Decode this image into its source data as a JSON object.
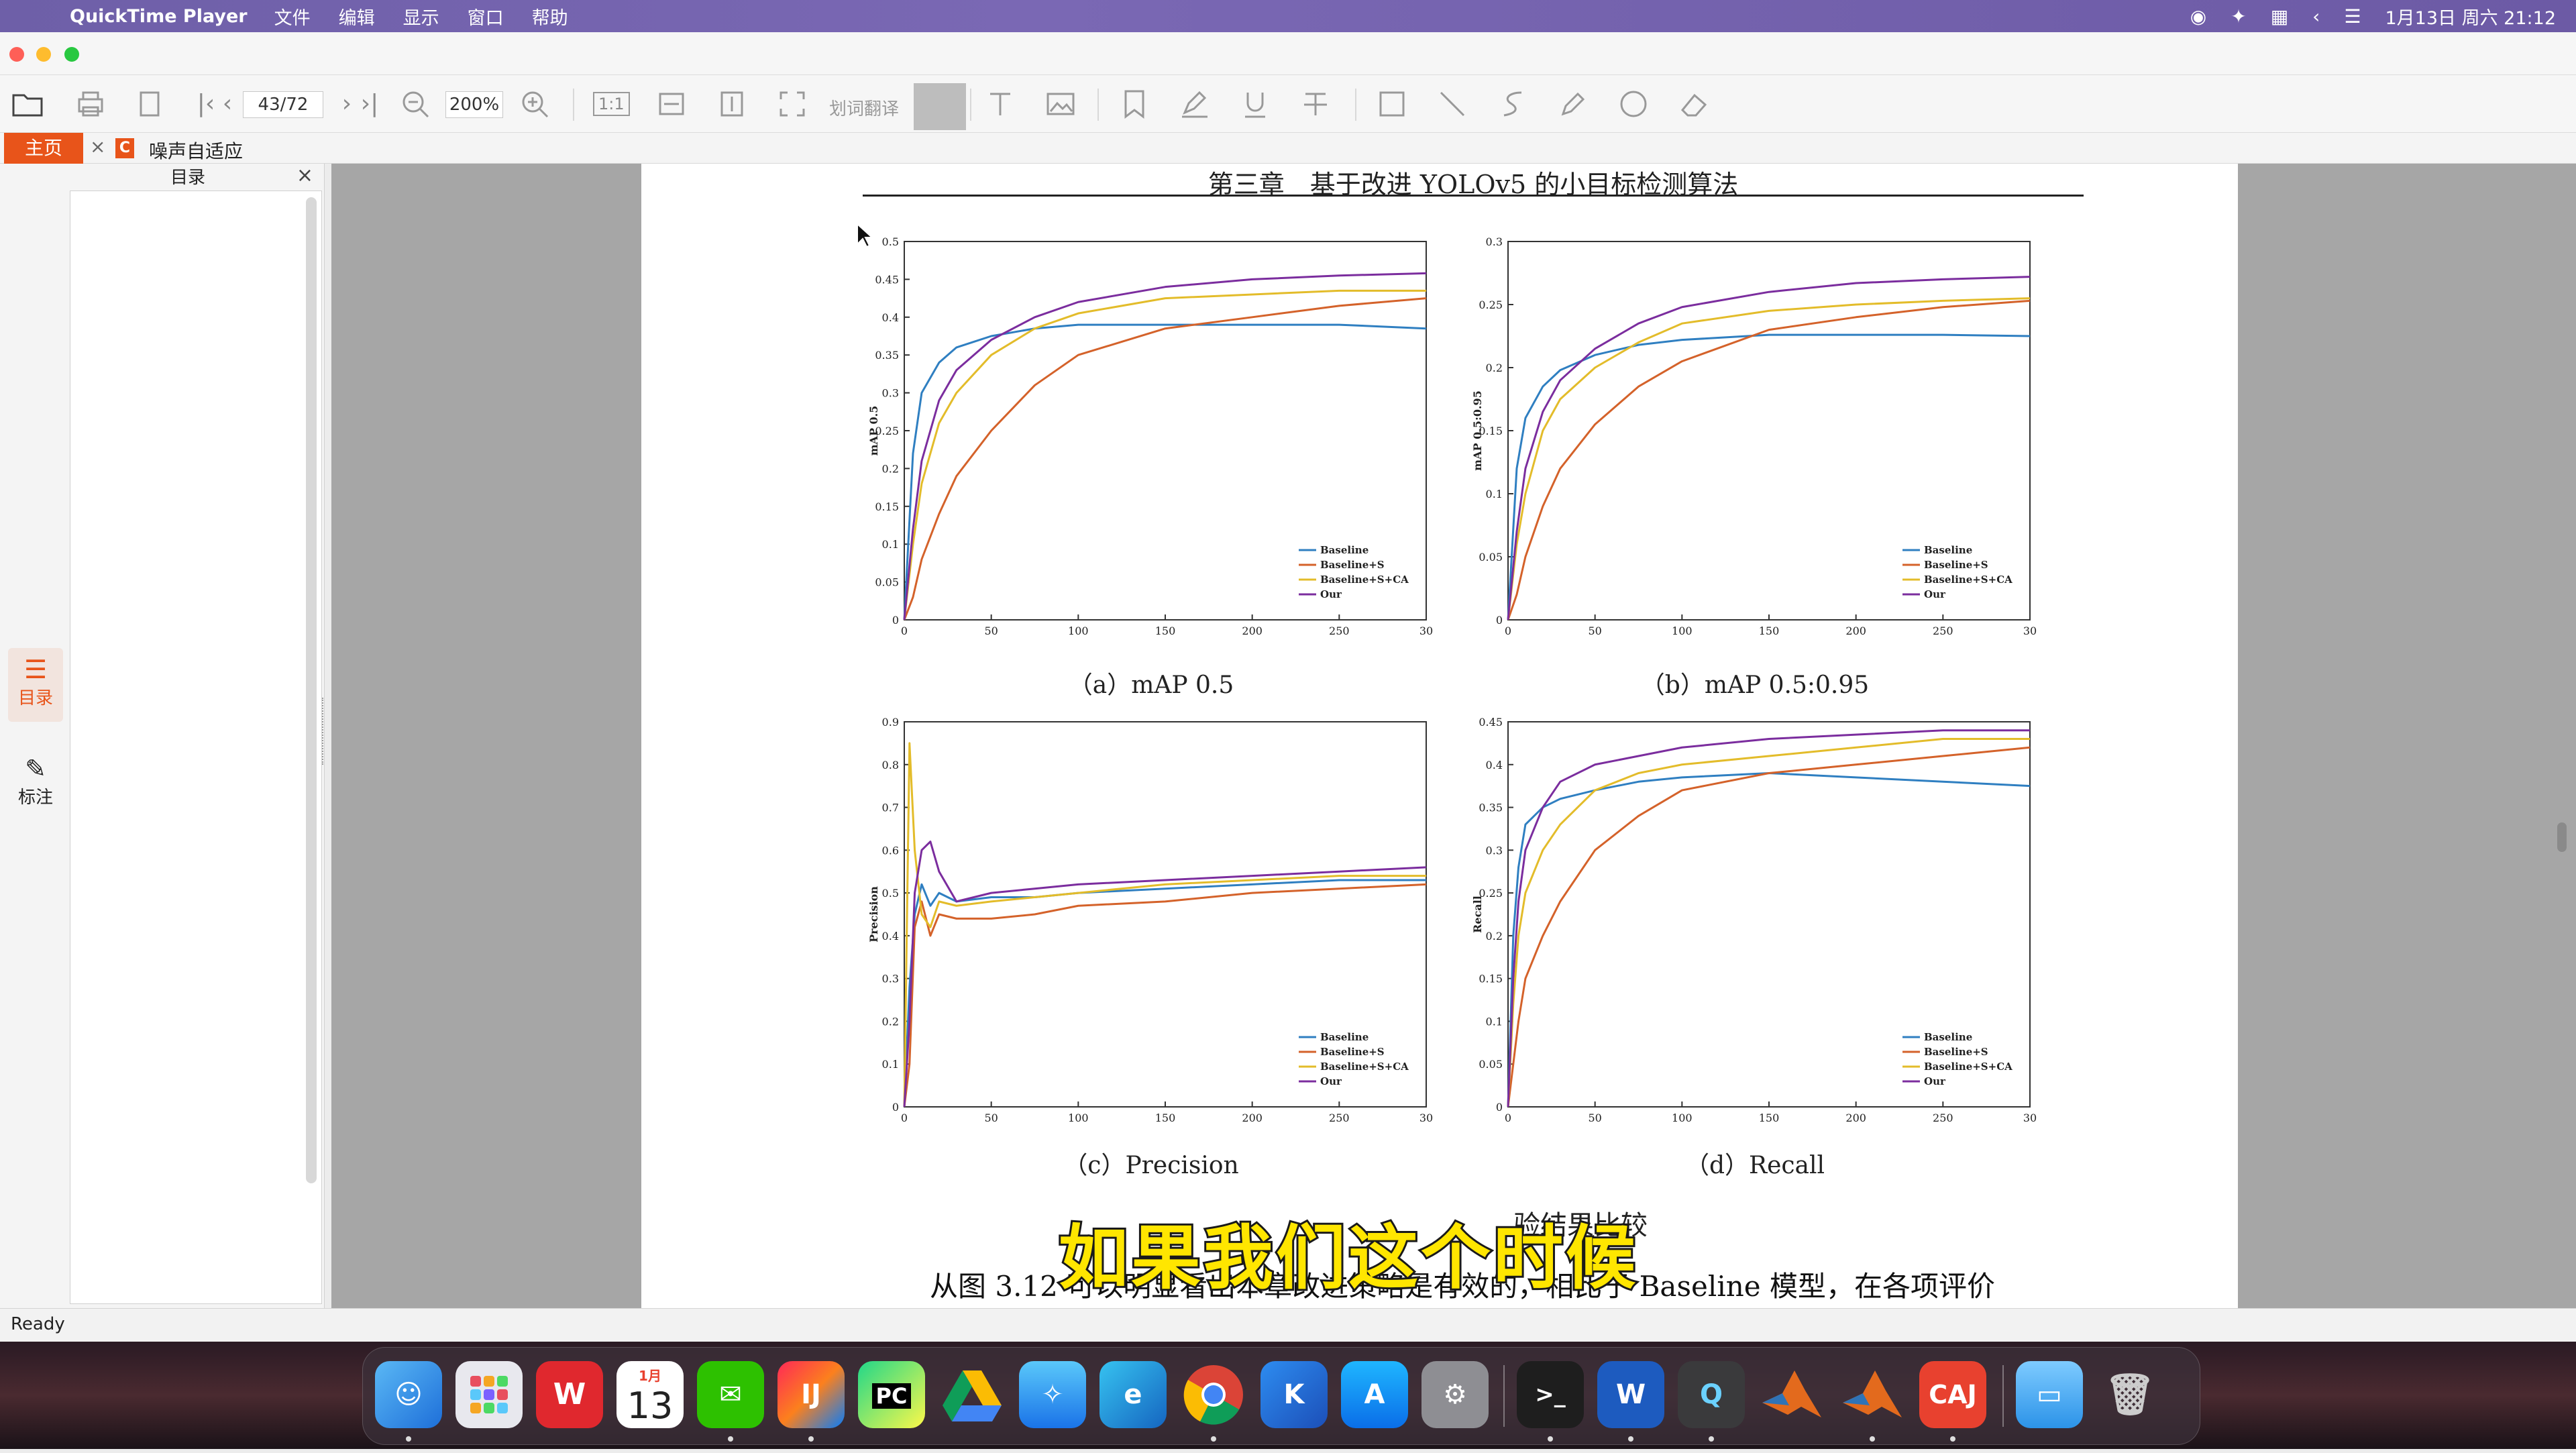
{
  "menubar": {
    "app_name": "QuickTime Player",
    "menus": [
      "文件",
      "编辑",
      "显示",
      "窗口",
      "帮助"
    ],
    "clock": "1月13日 周六 21:12"
  },
  "toolbar": {
    "page_indicator": "43/72",
    "zoom": "200%",
    "actual_size_label": "1:1",
    "translate_label": "划词翻译"
  },
  "tabs": {
    "home": "主页",
    "doc_icon_letter": "C",
    "doc_title": "噪声自适应"
  },
  "leftrail": {
    "toc_label": "目录",
    "annotate_label": "标注"
  },
  "toc": {
    "title": "目录"
  },
  "document": {
    "header": "第三章　基于改进 YOLOv5 的小目标检测算法",
    "captions": {
      "a": "（a）mAP 0.5",
      "b": "（b）mAP 0.5:0.95",
      "c": "（c）Precision",
      "d": "（d）Recall"
    },
    "figure_caption_tail": "验结果比较",
    "body_line": "从图 3.12 可以明显看出本章改进策略是有效的，相比于 Baseline 模型，在各项评价"
  },
  "subtitle": "如果我们这个时候",
  "status": "Ready",
  "dock": {
    "calendar_month": "1月",
    "calendar_day": "13",
    "caj_label": "CAJ"
  },
  "colors": {
    "baseline": "#2f7fc1",
    "baseline_s": "#d4622a",
    "baseline_s_ca": "#e3bc2a",
    "our": "#7b2d9e",
    "accent": "#e8541a"
  },
  "chart_data": [
    {
      "type": "line",
      "ylabel": "mAP 0.5",
      "xlim": [
        0,
        300
      ],
      "ylim": [
        0,
        0.5
      ],
      "xticks": [
        "0",
        "50",
        "100",
        "150",
        "200",
        "250",
        "30"
      ],
      "yticks": [
        "0",
        "0.05",
        "0.1",
        "0.15",
        "0.2",
        "0.25",
        "0.3",
        "0.35",
        "0.4",
        "0.45",
        "0.5"
      ],
      "legend": "bottom-right",
      "x": [
        0,
        5,
        10,
        20,
        30,
        50,
        75,
        100,
        150,
        200,
        250,
        300
      ],
      "series": [
        {
          "name": "Baseline",
          "values": [
            0,
            0.22,
            0.3,
            0.34,
            0.36,
            0.375,
            0.385,
            0.39,
            0.39,
            0.39,
            0.39,
            0.385
          ]
        },
        {
          "name": "Baseline+S",
          "values": [
            0,
            0.03,
            0.08,
            0.14,
            0.19,
            0.25,
            0.31,
            0.35,
            0.385,
            0.4,
            0.415,
            0.425
          ]
        },
        {
          "name": "Baseline+S+CA",
          "values": [
            0,
            0.1,
            0.18,
            0.26,
            0.3,
            0.35,
            0.385,
            0.405,
            0.425,
            0.43,
            0.435,
            0.435
          ]
        },
        {
          "name": "Our",
          "values": [
            0,
            0.12,
            0.21,
            0.29,
            0.33,
            0.37,
            0.4,
            0.42,
            0.44,
            0.45,
            0.455,
            0.458
          ]
        }
      ]
    },
    {
      "type": "line",
      "ylabel": "mAP 0.5:0.95",
      "xlim": [
        0,
        300
      ],
      "ylim": [
        0,
        0.3
      ],
      "xticks": [
        "0",
        "50",
        "100",
        "150",
        "200",
        "250",
        "30"
      ],
      "yticks": [
        "0",
        "0.05",
        "0.1",
        "0.15",
        "0.2",
        "0.25",
        "0.3"
      ],
      "legend": "bottom-right",
      "x": [
        0,
        5,
        10,
        20,
        30,
        50,
        75,
        100,
        150,
        200,
        250,
        300
      ],
      "series": [
        {
          "name": "Baseline",
          "values": [
            0,
            0.12,
            0.16,
            0.185,
            0.198,
            0.21,
            0.218,
            0.222,
            0.226,
            0.226,
            0.226,
            0.225
          ]
        },
        {
          "name": "Baseline+S",
          "values": [
            0,
            0.02,
            0.05,
            0.09,
            0.12,
            0.155,
            0.185,
            0.205,
            0.23,
            0.24,
            0.248,
            0.253
          ]
        },
        {
          "name": "Baseline+S+CA",
          "values": [
            0,
            0.06,
            0.1,
            0.15,
            0.175,
            0.2,
            0.22,
            0.235,
            0.245,
            0.25,
            0.253,
            0.255
          ]
        },
        {
          "name": "Our",
          "values": [
            0,
            0.07,
            0.12,
            0.165,
            0.19,
            0.215,
            0.235,
            0.248,
            0.26,
            0.267,
            0.27,
            0.272
          ]
        }
      ]
    },
    {
      "type": "line",
      "ylabel": "Precision",
      "xlim": [
        0,
        300
      ],
      "ylim": [
        0,
        0.9
      ],
      "xticks": [
        "0",
        "50",
        "100",
        "150",
        "200",
        "250",
        "30"
      ],
      "yticks": [
        "0",
        "0.1",
        "0.2",
        "0.3",
        "0.4",
        "0.5",
        "0.6",
        "0.7",
        "0.8",
        "0.9"
      ],
      "legend": "bottom-right",
      "x": [
        0,
        3,
        6,
        10,
        15,
        20,
        30,
        50,
        75,
        100,
        150,
        200,
        250,
        300
      ],
      "series": [
        {
          "name": "Baseline",
          "values": [
            0,
            0.28,
            0.45,
            0.52,
            0.47,
            0.5,
            0.48,
            0.49,
            0.49,
            0.5,
            0.51,
            0.52,
            0.53,
            0.53
          ]
        },
        {
          "name": "Baseline+S",
          "values": [
            0,
            0.1,
            0.42,
            0.48,
            0.4,
            0.45,
            0.44,
            0.44,
            0.45,
            0.47,
            0.48,
            0.5,
            0.51,
            0.52
          ]
        },
        {
          "name": "Baseline+S+CA",
          "values": [
            0,
            0.85,
            0.6,
            0.45,
            0.42,
            0.48,
            0.47,
            0.48,
            0.49,
            0.5,
            0.52,
            0.53,
            0.54,
            0.54
          ]
        },
        {
          "name": "Our",
          "values": [
            0,
            0.2,
            0.5,
            0.6,
            0.62,
            0.55,
            0.48,
            0.5,
            0.51,
            0.52,
            0.53,
            0.54,
            0.55,
            0.56
          ]
        }
      ]
    },
    {
      "type": "line",
      "ylabel": "Recall",
      "xlim": [
        0,
        300
      ],
      "ylim": [
        0,
        0.45
      ],
      "xticks": [
        "0",
        "50",
        "100",
        "150",
        "200",
        "250",
        "30"
      ],
      "yticks": [
        "0",
        "0.05",
        "0.1",
        "0.15",
        "0.2",
        "0.25",
        "0.3",
        "0.35",
        "0.4",
        "0.45"
      ],
      "legend": "bottom-right",
      "x": [
        0,
        3,
        6,
        10,
        20,
        30,
        50,
        75,
        100,
        150,
        200,
        250,
        300
      ],
      "series": [
        {
          "name": "Baseline",
          "values": [
            0,
            0.2,
            0.28,
            0.33,
            0.35,
            0.36,
            0.37,
            0.38,
            0.385,
            0.39,
            0.385,
            0.38,
            0.375
          ]
        },
        {
          "name": "Baseline+S",
          "values": [
            0,
            0.05,
            0.1,
            0.15,
            0.2,
            0.24,
            0.3,
            0.34,
            0.37,
            0.39,
            0.4,
            0.41,
            0.42
          ]
        },
        {
          "name": "Baseline+S+CA",
          "values": [
            0,
            0.12,
            0.2,
            0.25,
            0.3,
            0.33,
            0.37,
            0.39,
            0.4,
            0.41,
            0.42,
            0.43,
            0.43
          ]
        },
        {
          "name": "Our",
          "values": [
            0,
            0.15,
            0.24,
            0.3,
            0.35,
            0.38,
            0.4,
            0.41,
            0.42,
            0.43,
            0.435,
            0.44,
            0.44
          ]
        }
      ]
    }
  ]
}
